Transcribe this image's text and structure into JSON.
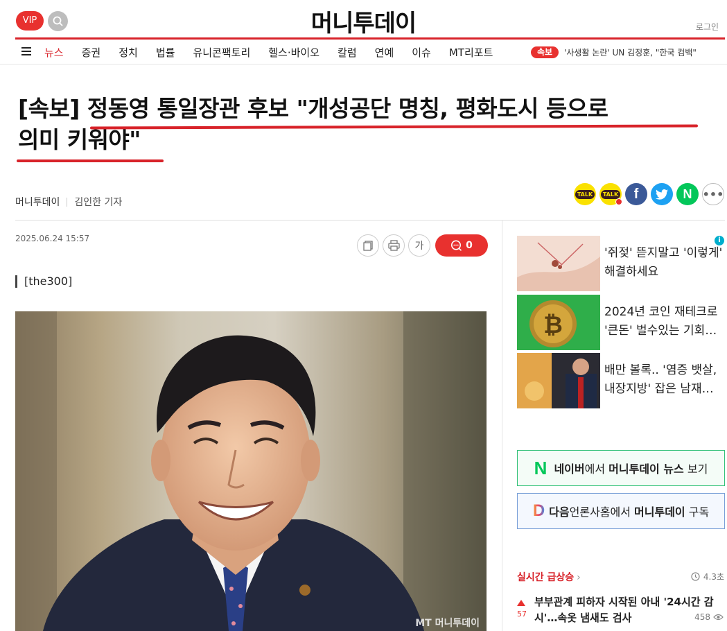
{
  "header": {
    "vip_label": "VIP",
    "logo": "머니투데이",
    "login_label": "로그인"
  },
  "nav": {
    "items": [
      "뉴스",
      "증권",
      "정치",
      "법률",
      "유니콘팩토리",
      "헬스·바이오",
      "칼럼",
      "연예",
      "이슈",
      "MT리포트"
    ],
    "breaking_badge": "속보",
    "breaking_text": "'사생활 논란' UN 김정훈, \"한국 컴백\""
  },
  "article": {
    "headline_line1": "[속보] 정동영 통일장관 후보 \"개성공단 명칭, 평화도시 등으로",
    "headline_line2": "의미 키워야\"",
    "publisher": "머니투데이",
    "reporter": "김인한 기자",
    "date": "2025.06.24 15:57",
    "font_tool_label": "가",
    "comment_count": "0",
    "kicker": "[the300]",
    "photo_watermark": "MT 머니투데이"
  },
  "share": [
    "kakaotalk-icon",
    "kakaostory-icon",
    "facebook-icon",
    "twitter-icon",
    "naver-icon",
    "more-icon"
  ],
  "sidebar": {
    "ads": [
      {
        "text": "'쥐젖' 뜯지말고 '이렇게' 해결하세요"
      },
      {
        "text": "2024년 코인 재테크로 '큰돈' 벌수있는 기회…"
      },
      {
        "text": "배만 볼록.. '염증 뱃살, 내장지방' 잡은 남재…"
      }
    ],
    "naver_cta": {
      "prefix": "네이버",
      "mid": "에서 ",
      "brand": "머니투데이 뉴스",
      "suffix": " 보기"
    },
    "daum_cta": {
      "prefix": "다음",
      "mid": "언론사홈에서 ",
      "brand": "머니투데이",
      "suffix": " 구독"
    },
    "trending_title": "실시간 급상승",
    "trending_time": "4.3초",
    "trending_item": {
      "rank_change": "57",
      "title": "부부관계 피하자 시작된 아내 '24시간 감시'…속옷 냄새도 검사",
      "views": "458"
    }
  },
  "colors": {
    "accent_red": "#d8232a",
    "naver_green": "#03c75a",
    "kakao_yellow": "#fae100",
    "facebook_blue": "#3b5998",
    "twitter_blue": "#1da1f2"
  }
}
